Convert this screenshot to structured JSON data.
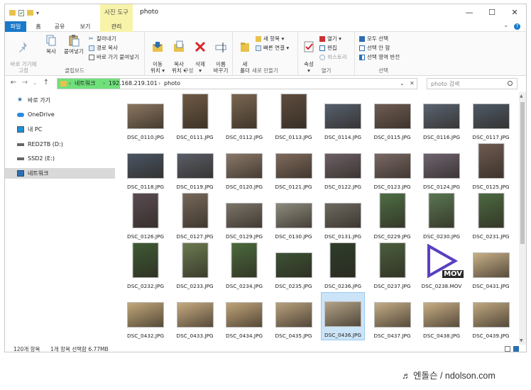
{
  "window": {
    "title": "photo",
    "context_tab": "사진 도구",
    "controls": {
      "minimize": "—",
      "maximize": "☐",
      "close": "✕"
    }
  },
  "tabs": [
    {
      "label": "파일"
    },
    {
      "label": "홈"
    },
    {
      "label": "공유"
    },
    {
      "label": "보기"
    },
    {
      "label": "관리"
    }
  ],
  "ribbon": {
    "clipboard": {
      "label": "클립보드",
      "pin": "바로 가기에\n고정",
      "copy": "복사",
      "paste": "붙여넣기",
      "cut": "잘라내기",
      "copy_path": "경로 복사",
      "paste_shortcut": "바로 가기 붙여넣기"
    },
    "organize": {
      "label": "구성",
      "move": "이동\n위치 ▾",
      "copyto": "복사\n위치 ▾",
      "delete": "삭제\n▾",
      "rename": "이름\n바꾸기"
    },
    "new": {
      "label": "새로 만들기",
      "folder": "새\n폴더",
      "new_item": "새 항목 ▾",
      "easy_access": "빠른 연결 ▾"
    },
    "open": {
      "label": "열기",
      "properties": "속성\n▾",
      "open": "열기 ▾",
      "edit": "편집",
      "history": "히스토리"
    },
    "select": {
      "label": "선택",
      "all": "모두 선택",
      "none": "선택 안 함",
      "invert": "선택 영역 반전"
    }
  },
  "address": {
    "crumbs": [
      "네트워크",
      "192.168.219.101",
      "photo"
    ],
    "search_placeholder": "photo 검색"
  },
  "nav": [
    {
      "label": "바로 가기",
      "icon": "star-icon"
    },
    {
      "label": "OneDrive",
      "icon": "cloud-icon"
    },
    {
      "label": "내 PC",
      "icon": "monitor-icon"
    },
    {
      "label": "RED2TB (D:)",
      "icon": "drive-icon"
    },
    {
      "label": "SSD2 (E:)",
      "icon": "drive-icon"
    },
    {
      "label": "네트워크",
      "icon": "network-icon"
    }
  ],
  "files": [
    {
      "name": "DSC_0110.JPG",
      "o": "l",
      "c": "#8a7660"
    },
    {
      "name": "DSC_0111.JPG",
      "o": "p",
      "c": "#6e5a44"
    },
    {
      "name": "DSC_0112.JPG",
      "o": "p",
      "c": "#7a6650"
    },
    {
      "name": "DSC_0113.JPG",
      "o": "p",
      "c": "#5e4c3e"
    },
    {
      "name": "DSC_0114.JPG",
      "o": "l",
      "c": "#56606e"
    },
    {
      "name": "DSC_0115.JPG",
      "o": "l",
      "c": "#6e5c52"
    },
    {
      "name": "DSC_0116.JPG",
      "o": "l",
      "c": "#5a6472"
    },
    {
      "name": "DSC_0117.JPG",
      "o": "l",
      "c": "#4e5a66"
    },
    {
      "name": "DSC_0118.JPG",
      "o": "l",
      "c": "#4a5664"
    },
    {
      "name": "DSC_0119.JPG",
      "o": "l",
      "c": "#5a5e68"
    },
    {
      "name": "DSC_0120.JPG",
      "o": "l",
      "c": "#8a7868"
    },
    {
      "name": "DSC_0121.JPG",
      "o": "l",
      "c": "#7e6a5c"
    },
    {
      "name": "DSC_0122.JPG",
      "o": "l",
      "c": "#6c6066"
    },
    {
      "name": "DSC_0123.JPG",
      "o": "l",
      "c": "#7a6864"
    },
    {
      "name": "DSC_0124.JPG",
      "o": "l",
      "c": "#6e6470"
    },
    {
      "name": "DSC_0125.JPG",
      "o": "p",
      "c": "#6e5a50"
    },
    {
      "name": "DSC_0126.JPG",
      "o": "p",
      "c": "#5a4c52"
    },
    {
      "name": "DSC_0127.JPG",
      "o": "p",
      "c": "#76685a"
    },
    {
      "name": "DSC_0129.JPG",
      "o": "l",
      "c": "#7c7468"
    },
    {
      "name": "DSC_0130.JPG",
      "o": "l",
      "c": "#8c8a7c"
    },
    {
      "name": "DSC_0131.JPG",
      "o": "l",
      "c": "#6e6a60"
    },
    {
      "name": "DSC_0229.JPG",
      "o": "p",
      "c": "#4e6e44"
    },
    {
      "name": "DSC_0230.JPG",
      "o": "p",
      "c": "#5a7650"
    },
    {
      "name": "DSC_0231.JPG",
      "o": "p",
      "c": "#4c6a40"
    },
    {
      "name": "DSC_0232.JPG",
      "o": "p",
      "c": "#3e5a34"
    },
    {
      "name": "DSC_0233.JPG",
      "o": "p",
      "c": "#6a7a50"
    },
    {
      "name": "DSC_0234.JPG",
      "o": "p",
      "c": "#4a6a3c"
    },
    {
      "name": "DSC_0235.JPG",
      "o": "l",
      "c": "#3c5234"
    },
    {
      "name": "DSC_0236.JPG",
      "o": "p",
      "c": "#2e3e2a"
    },
    {
      "name": "DSC_0237.JPG",
      "o": "p",
      "c": "#4a5e3c"
    },
    {
      "name": "DSC_0238.MOV",
      "o": "mov",
      "c": "#5a3fc0"
    },
    {
      "name": "DSC_0431.JPG",
      "o": "l",
      "c": "#c8b088"
    },
    {
      "name": "DSC_0432.JPG",
      "o": "l",
      "c": "#c2a87a"
    },
    {
      "name": "DSC_0433.JPG",
      "o": "l",
      "c": "#c6aa80"
    },
    {
      "name": "DSC_0434.JPG",
      "o": "l",
      "c": "#c0a478"
    },
    {
      "name": "DSC_0435.JPG",
      "o": "l",
      "c": "#b8a07c"
    },
    {
      "name": "DSC_0436.JPG",
      "o": "l",
      "c": "#b2a286"
    },
    {
      "name": "DSC_0437.JPG",
      "o": "l",
      "c": "#c4ac86"
    },
    {
      "name": "DSC_0438.JPG",
      "o": "l",
      "c": "#c8ae84"
    },
    {
      "name": "DSC_0439.JPG",
      "o": "l",
      "c": "#c0a880"
    }
  ],
  "selected_file": "DSC_0436.JPG",
  "mov_badge": "MOV",
  "status": {
    "count": "120개 항목",
    "selection": "1개 항목 선택함 6.77MB"
  },
  "credit": "♬ 엔돌슨 / ndolson.com",
  "colors": {
    "accent": "#1979ca",
    "context_tab": "#f7f3a9",
    "selection": "#cce4f7",
    "address_highlight": "#6fe07a",
    "mov_play": "#5a3fc0"
  }
}
